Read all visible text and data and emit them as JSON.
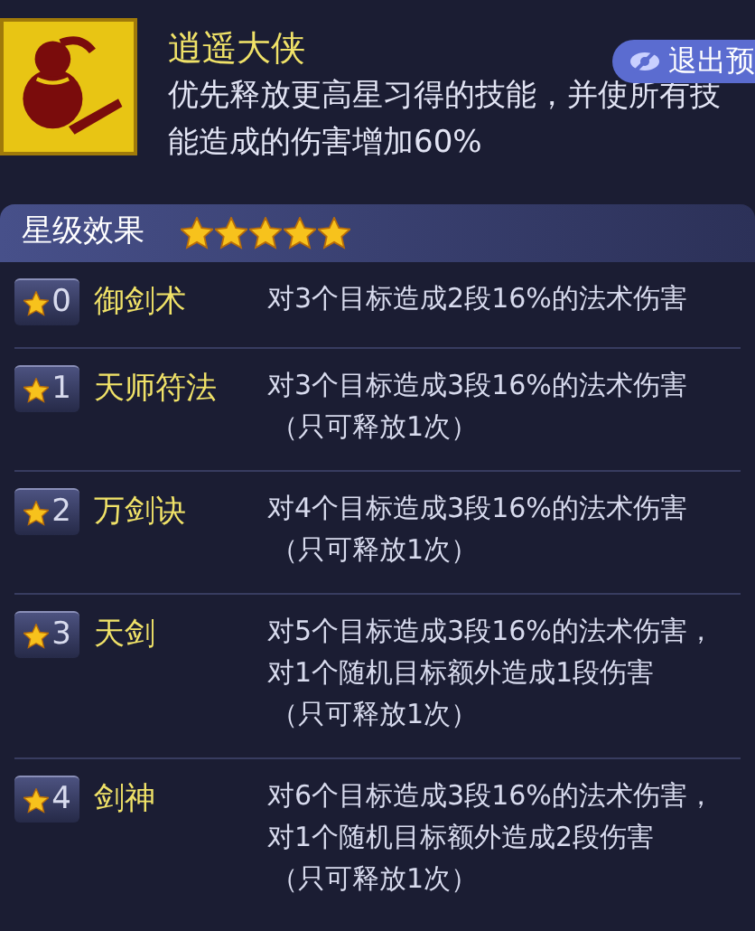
{
  "header": {
    "title": "逍遥大侠",
    "button": "退出预",
    "description_lines": [
      "优先释放更高星习得的技能，并使所有技",
      "能造成的伤害增加60%"
    ]
  },
  "star_section": {
    "title": "星级效果",
    "stars": 5
  },
  "effects": [
    {
      "level": "0",
      "name": "御剑术",
      "lines": [
        "对3个目标造成2段16%的法术伤害"
      ]
    },
    {
      "level": "1",
      "name": "天师符法",
      "lines": [
        "对3个目标造成3段16%的法术伤害",
        "（只可释放1次）"
      ]
    },
    {
      "level": "2",
      "name": "万剑诀",
      "lines": [
        "对4个目标造成3段16%的法术伤害",
        "（只可释放1次）"
      ]
    },
    {
      "level": "3",
      "name": "天剑",
      "lines": [
        "对5个目标造成3段16%的法术伤害，",
        "对1个随机目标额外造成1段伤害",
        "（只可释放1次）"
      ]
    },
    {
      "level": "4",
      "name": "剑神",
      "lines": [
        "对6个目标造成3段16%的法术伤害，",
        "对1个随机目标额外造成2段伤害",
        "（只可释放1次）"
      ]
    }
  ]
}
